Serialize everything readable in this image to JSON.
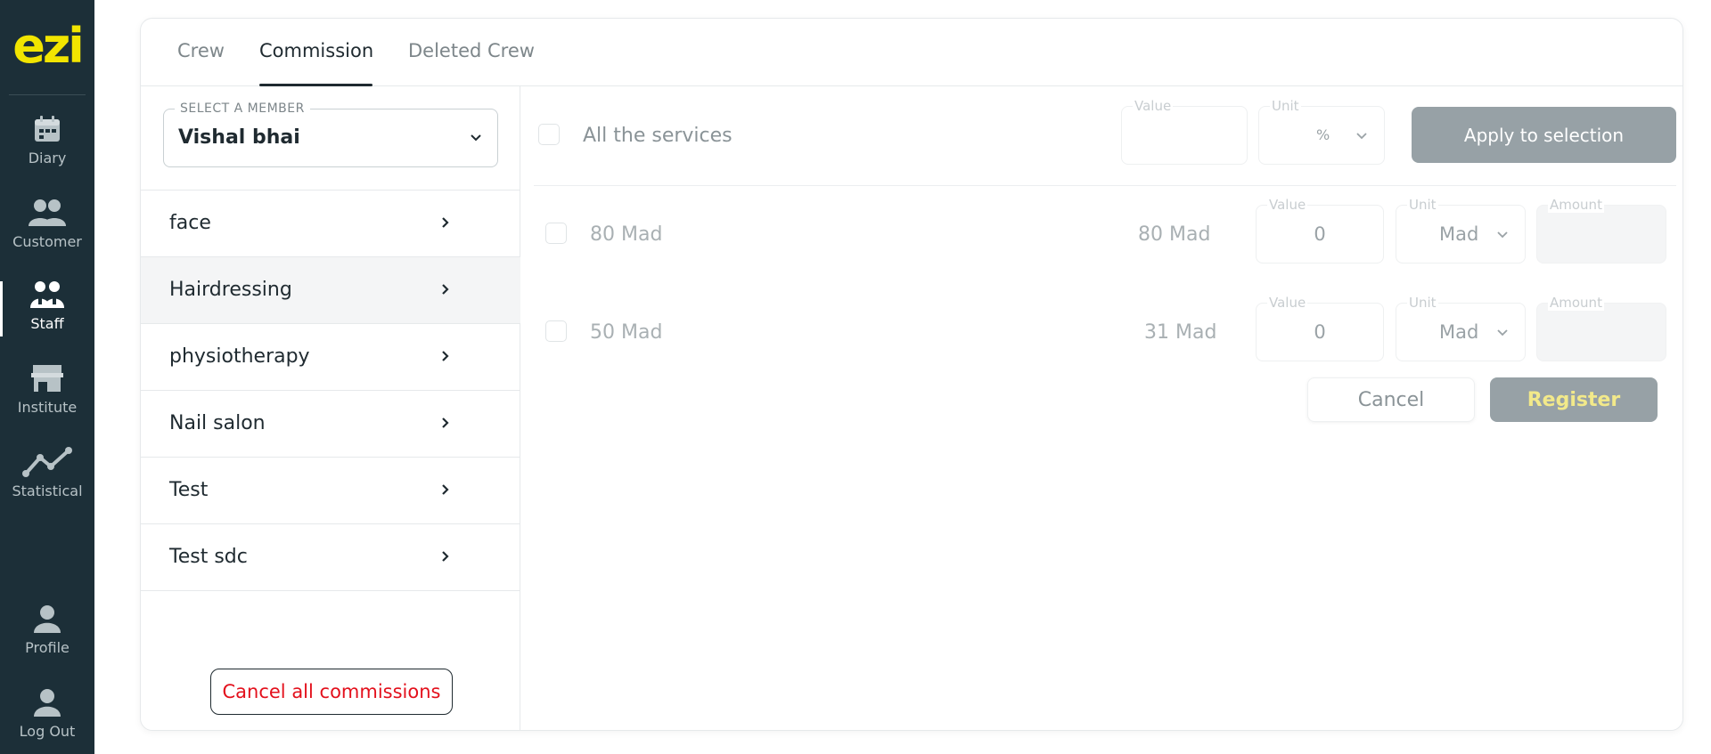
{
  "app": {
    "logo": "ezi"
  },
  "sidebar": {
    "items": [
      {
        "label": "Diary",
        "icon": "calendar-icon"
      },
      {
        "label": "Customer",
        "icon": "users-icon"
      },
      {
        "label": "Staff",
        "icon": "staff-icon",
        "active": true
      },
      {
        "label": "Institute",
        "icon": "store-icon"
      },
      {
        "label": "Statistical",
        "icon": "chart-line-icon"
      }
    ],
    "bottom": [
      {
        "label": "Profile",
        "icon": "user-icon"
      },
      {
        "label": "Log Out",
        "icon": "logout-icon"
      }
    ]
  },
  "tabs": [
    {
      "label": "Crew"
    },
    {
      "label": "Commission",
      "active": true
    },
    {
      "label": "Deleted Crew"
    }
  ],
  "member_select": {
    "legend": "SELECT A MEMBER",
    "value": "Vishal bhai"
  },
  "categories": [
    {
      "label": "face"
    },
    {
      "label": "Hairdressing",
      "selected": true
    },
    {
      "label": "physiotherapy"
    },
    {
      "label": "Nail salon"
    },
    {
      "label": "Test"
    },
    {
      "label": "Test sdc"
    }
  ],
  "cancel_all_label": "Cancel all commissions",
  "all_services": {
    "label": "All the services",
    "value_legend": "Value",
    "value": "",
    "unit_legend": "Unit",
    "unit_value": "%",
    "apply_label": "Apply to selection"
  },
  "services": [
    {
      "name": "80 Mad",
      "price": "80 Mad",
      "value_legend": "Value",
      "value": "0",
      "unit_legend": "Unit",
      "unit": "Mad",
      "amount_legend": "Amount"
    },
    {
      "name": "50 Mad",
      "price": "31 Mad",
      "value_legend": "Value",
      "value": "0",
      "unit_legend": "Unit",
      "unit": "Mad",
      "amount_legend": "Amount"
    }
  ],
  "actions": {
    "cancel": "Cancel",
    "register": "Register"
  },
  "colors": {
    "sidebar_bg": "#1c2f38",
    "logo": "#f2e500",
    "danger": "#e3101c",
    "disabled_btn": "#97a1a6"
  }
}
